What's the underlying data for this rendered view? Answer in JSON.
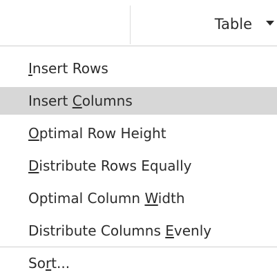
{
  "toolbar": {
    "table_label": "Table"
  },
  "menu": {
    "items": [
      {
        "parts": [
          "",
          "I",
          "nsert Rows"
        ]
      },
      {
        "parts": [
          "Insert ",
          "C",
          "olumns"
        ]
      },
      {
        "parts": [
          "",
          "O",
          "ptimal Row Height"
        ]
      },
      {
        "parts": [
          "",
          "D",
          "istribute Rows Equally"
        ]
      },
      {
        "parts": [
          "Optimal Column ",
          "W",
          "idth"
        ]
      },
      {
        "parts": [
          "Distribute Columns ",
          "E",
          "venly"
        ]
      },
      {
        "parts": [
          "So",
          "r",
          "t..."
        ]
      }
    ]
  },
  "colors": {
    "highlight": "#d7d7d7",
    "text": "#2b2b2b",
    "separator": "#cfcfcf"
  }
}
